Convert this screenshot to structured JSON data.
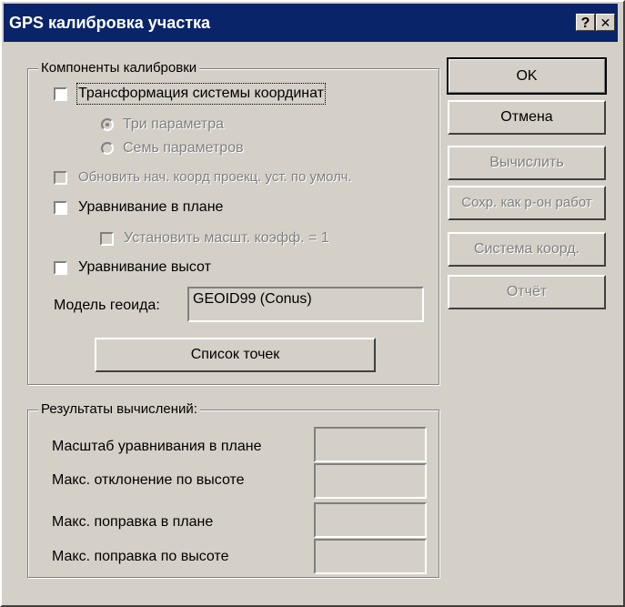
{
  "window": {
    "title": "GPS калибровка участка",
    "help_button": "?",
    "close_button": "✕"
  },
  "calibration_group": {
    "legend": "Компоненты калибровки",
    "transform_checkbox": {
      "label": "Трансформация системы координат",
      "checked": false,
      "enabled": true
    },
    "three_params_radio": {
      "label": "Три параметра",
      "selected": true,
      "enabled": false
    },
    "seven_params_radio": {
      "label": "Семь параметров",
      "selected": false,
      "enabled": false
    },
    "update_origin_checkbox": {
      "label": "Обновить нач. коорд проекц. уст. по умолч.",
      "checked": false,
      "enabled": false
    },
    "horizontal_adjust_checkbox": {
      "label": "Уравнивание в плане",
      "checked": false,
      "enabled": true
    },
    "scale_factor_checkbox": {
      "label": "Установить масшт. коэфф. = 1",
      "checked": false,
      "enabled": false
    },
    "vertical_adjust_checkbox": {
      "label": "Уравнивание высот",
      "checked": false,
      "enabled": true
    },
    "geoid_label": "Модель геоида:",
    "geoid_value": "GEOID99 (Conus)",
    "point_list_button": "Список точек"
  },
  "results_group": {
    "legend": "Результаты вычислений:",
    "rows": [
      {
        "label": "Масштаб уравнивания в плане",
        "value": ""
      },
      {
        "label": "Макс. отклонение по высоте",
        "value": ""
      },
      {
        "label": "Макс. поправка в плане",
        "value": ""
      },
      {
        "label": "Макс. поправка по высоте",
        "value": ""
      }
    ]
  },
  "buttons": {
    "ok": "OK",
    "cancel": "Отмена",
    "compute": "Вычислить",
    "save_as_workspace": "Сохр. как р-он работ",
    "coord_system": "Система коорд.",
    "report": "Отчёт"
  },
  "colors": {
    "titlebar": "#0a246a",
    "face": "#d4d0c8",
    "disabled_text": "#808080"
  }
}
